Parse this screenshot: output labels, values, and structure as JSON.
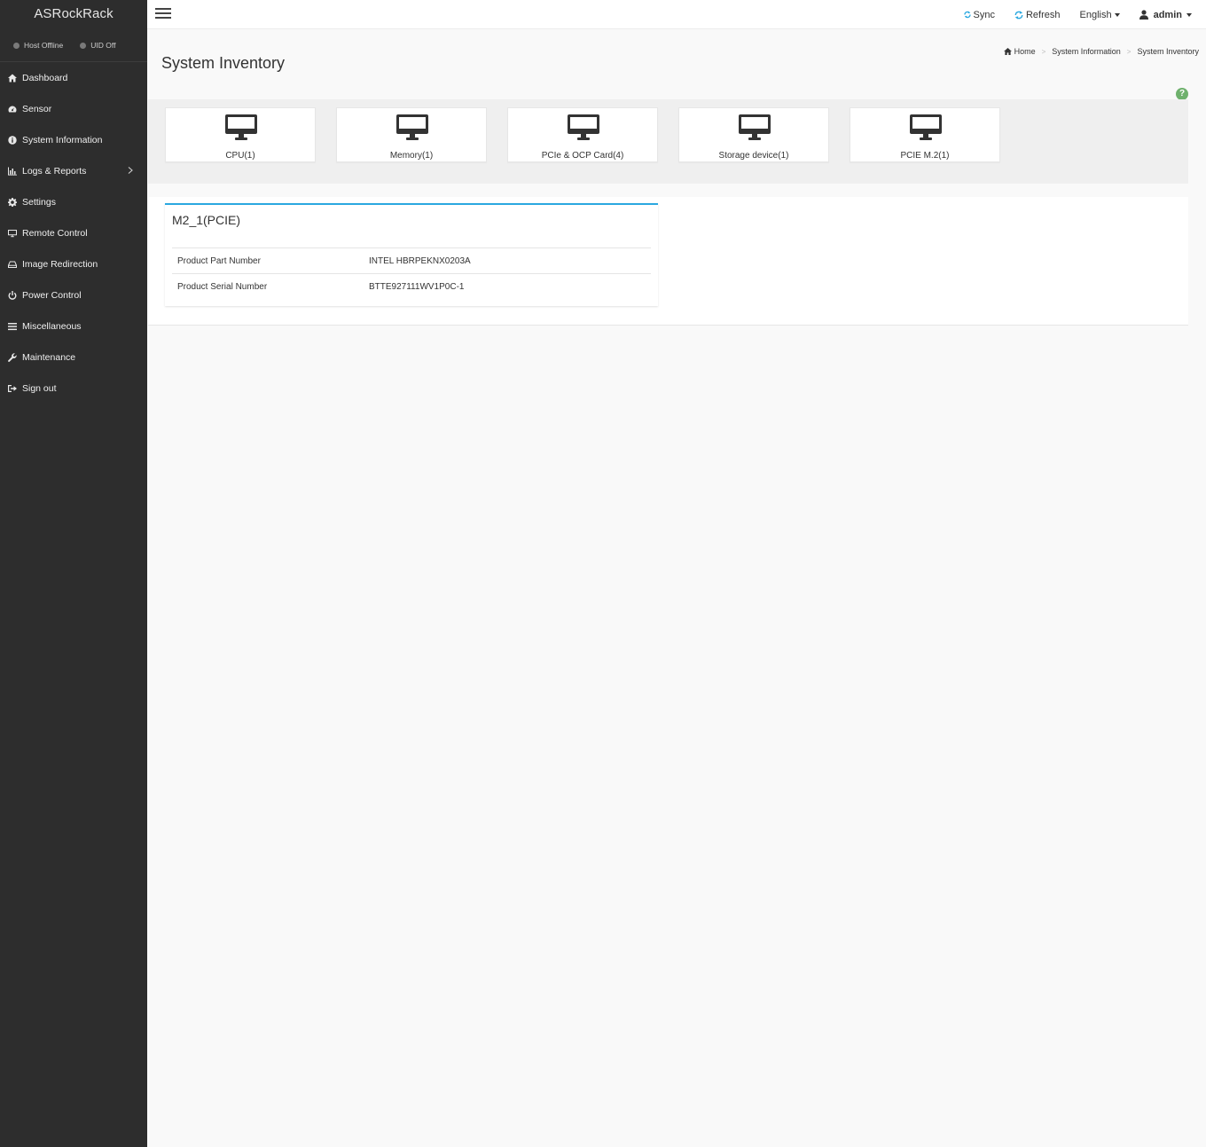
{
  "sidebar": {
    "brand": "ASRockRack",
    "status": {
      "host": "Host Offline",
      "uid": "UID Off"
    },
    "items": [
      {
        "label": "Dashboard",
        "icon": "home-icon"
      },
      {
        "label": "Sensor",
        "icon": "dashboard-gauge-icon"
      },
      {
        "label": "System Information",
        "icon": "info-circle-icon"
      },
      {
        "label": "Logs & Reports",
        "icon": "bar-chart-icon"
      },
      {
        "label": "Settings",
        "icon": "gear-icon"
      },
      {
        "label": "Remote Control",
        "icon": "monitor-icon"
      },
      {
        "label": "Image Redirection",
        "icon": "hdd-icon"
      },
      {
        "label": "Power Control",
        "icon": "power-icon"
      },
      {
        "label": "Miscellaneous",
        "icon": "list-icon"
      },
      {
        "label": "Maintenance",
        "icon": "wrench-icon"
      },
      {
        "label": "Sign out",
        "icon": "sign-out-icon"
      }
    ]
  },
  "topbar": {
    "sync": "Sync",
    "refresh": "Refresh",
    "language": "English",
    "user": "admin"
  },
  "page": {
    "title": "System Inventory",
    "breadcrumb": [
      "Home",
      "System Information",
      "System Inventory"
    ]
  },
  "cards": [
    {
      "label": "CPU(1)"
    },
    {
      "label": "Memory(1)"
    },
    {
      "label": "PCIe & OCP Card(4)"
    },
    {
      "label": "Storage device(1)"
    },
    {
      "label": "PCIE M.2(1)"
    }
  ],
  "detail": {
    "title": "M2_1(PCIE)",
    "rows": [
      {
        "key": "Product Part Number",
        "value": "INTEL HBRPEKNX0203A"
      },
      {
        "key": "Product Serial Number",
        "value": "BTTE927111WV1P0C-1"
      }
    ]
  },
  "colors": {
    "sidebar_bg": "#2d2d2d",
    "accent": "#2ba8e0",
    "help": "#6fb16d"
  }
}
